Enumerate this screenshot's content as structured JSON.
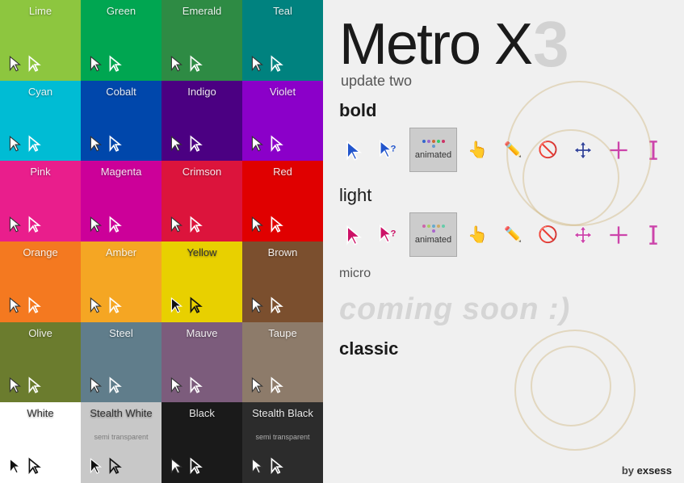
{
  "app": {
    "title": "Metro X",
    "subtitle": "update two",
    "number_badge": "3"
  },
  "tiles": [
    {
      "name": "Lime",
      "bg": "bg-lime",
      "dark": false,
      "sub": ""
    },
    {
      "name": "Green",
      "bg": "bg-green",
      "dark": false,
      "sub": ""
    },
    {
      "name": "Emerald",
      "bg": "bg-emerald",
      "dark": false,
      "sub": ""
    },
    {
      "name": "Teal",
      "bg": "bg-teal",
      "dark": false,
      "sub": ""
    },
    {
      "name": "Cyan",
      "bg": "bg-cyan",
      "dark": false,
      "sub": ""
    },
    {
      "name": "Cobalt",
      "bg": "bg-cobalt",
      "dark": false,
      "sub": ""
    },
    {
      "name": "Indigo",
      "bg": "bg-indigo",
      "dark": false,
      "sub": ""
    },
    {
      "name": "Violet",
      "bg": "bg-violet",
      "dark": false,
      "sub": ""
    },
    {
      "name": "Pink",
      "bg": "bg-pink",
      "dark": false,
      "sub": ""
    },
    {
      "name": "Magenta",
      "bg": "bg-magenta",
      "dark": false,
      "sub": ""
    },
    {
      "name": "Crimson",
      "bg": "bg-crimson",
      "dark": false,
      "sub": ""
    },
    {
      "name": "Red",
      "bg": "bg-red",
      "dark": false,
      "sub": ""
    },
    {
      "name": "Orange",
      "bg": "bg-orange",
      "dark": false,
      "sub": ""
    },
    {
      "name": "Amber",
      "bg": "bg-amber",
      "dark": false,
      "sub": ""
    },
    {
      "name": "Yellow",
      "bg": "bg-yellow",
      "dark": true,
      "sub": ""
    },
    {
      "name": "Brown",
      "bg": "bg-brown",
      "dark": false,
      "sub": ""
    },
    {
      "name": "Olive",
      "bg": "bg-olive",
      "dark": false,
      "sub": ""
    },
    {
      "name": "Steel",
      "bg": "bg-steel",
      "dark": false,
      "sub": ""
    },
    {
      "name": "Mauve",
      "bg": "bg-mauve",
      "dark": false,
      "sub": ""
    },
    {
      "name": "Taupe",
      "bg": "bg-taupe",
      "dark": false,
      "sub": ""
    },
    {
      "name": "White",
      "bg": "bg-white",
      "dark": true,
      "sub": ""
    },
    {
      "name": "Stealth White",
      "bg": "bg-stealth-white",
      "dark": true,
      "sub": "semi transparent"
    },
    {
      "name": "Black",
      "bg": "bg-black",
      "dark": false,
      "sub": ""
    },
    {
      "name": "Stealth Black",
      "bg": "bg-stealth-black",
      "dark": false,
      "sub": "semi transparent"
    }
  ],
  "sections": {
    "bold_label": "bold",
    "light_label": "light",
    "micro_label": "micro",
    "coming_soon": "coming soon :)",
    "classic_label": "classic",
    "animated_label": "animated",
    "by_text": "by ",
    "by_brand": "exsess"
  },
  "cursor_types": [
    "arrow",
    "arrow-question",
    "animated",
    "hand",
    "pencil",
    "no",
    "move",
    "crosshair",
    "text"
  ]
}
